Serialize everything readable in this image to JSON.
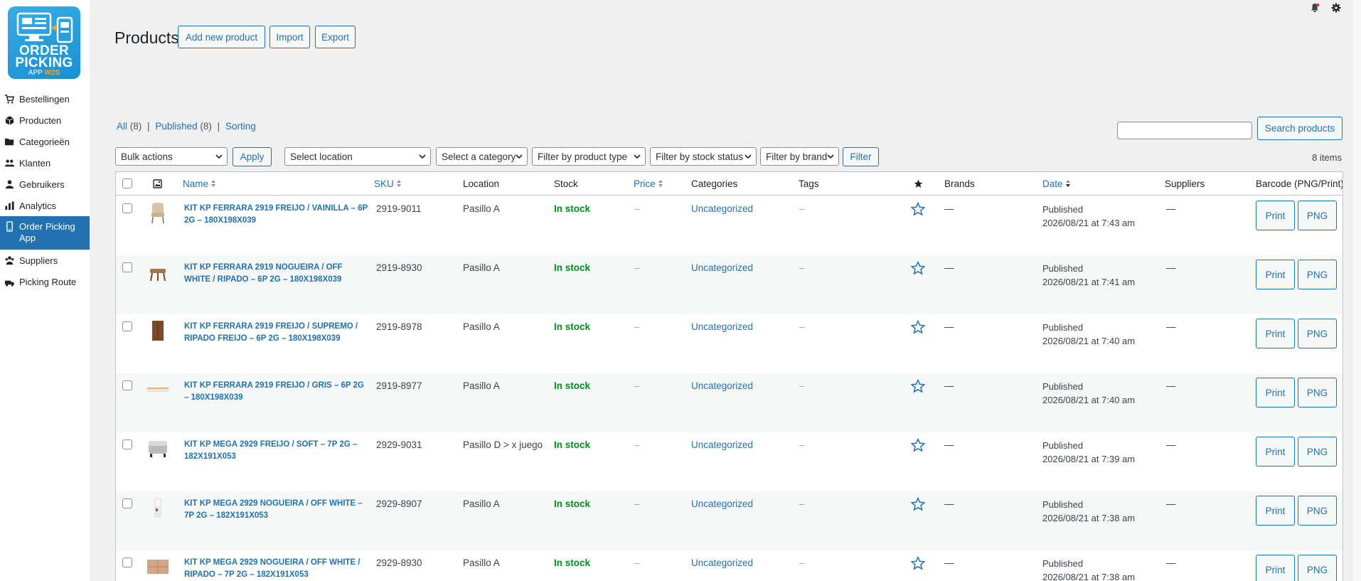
{
  "sidebar": {
    "logo": {
      "line1": "ORDER",
      "line2": "PICKING",
      "line3": "APP",
      "line3b": "W2S"
    },
    "items": [
      {
        "label": "Bestellingen",
        "icon": "cart-icon"
      },
      {
        "label": "Producten",
        "icon": "box-icon"
      },
      {
        "label": "Categorieën",
        "icon": "folder-icon"
      },
      {
        "label": "Klanten",
        "icon": "customers-icon"
      },
      {
        "label": "Gebruikers",
        "icon": "user-icon"
      },
      {
        "label": "Analytics",
        "icon": "bar-chart-icon"
      },
      {
        "label": "Order Picking App",
        "icon": "phone-icon",
        "active": true
      },
      {
        "label": "Suppliers",
        "icon": "suppliers-icon"
      },
      {
        "label": "Picking Route",
        "icon": "route-icon"
      }
    ]
  },
  "header": {
    "title": "Products",
    "buttons": [
      "Add new product",
      "Import",
      "Export"
    ]
  },
  "views": {
    "all": "All",
    "all_count": "(8)",
    "published": "Published",
    "published_count": "(8)",
    "sorting": "Sorting"
  },
  "search": {
    "placeholder": "",
    "button": "Search products"
  },
  "filters": {
    "bulk_actions": "Bulk actions",
    "apply": "Apply",
    "location": "Select location",
    "category": "Select a category",
    "product_type": "Filter by product type",
    "stock_status": "Filter by stock status",
    "brand": "Filter by brand",
    "filter_button": "Filter",
    "items_count": "8 items"
  },
  "columns": {
    "name": "Name",
    "sku": "SKU",
    "location": "Location",
    "stock": "Stock",
    "price": "Price",
    "categories": "Categories",
    "tags": "Tags",
    "brands": "Brands",
    "date": "Date",
    "suppliers": "Suppliers",
    "barcode": "Barcode (PNG/Print)"
  },
  "rows": [
    {
      "name": "KIT KP FERRARA 2919 FREIJO / VAINILLA – 6P 2G – 180X198X039",
      "sku": "2919-9011",
      "location": "Pasillo A",
      "stock": "In stock",
      "price": "–",
      "category": "Uncategorized",
      "tags": "–",
      "brands": "—",
      "date_status": "Published",
      "date": "2026/08/21 at 7:43 am",
      "suppliers": "—",
      "print": "Print",
      "png": "PNG",
      "thumb": "chair"
    },
    {
      "name": "KIT KP FERRARA 2919 NOGUEIRA / OFF WHITE / RIPADO – 6P 2G – 180X198X039",
      "sku": "2919-8930",
      "location": "Pasillo A",
      "stock": "In stock",
      "price": "–",
      "category": "Uncategorized",
      "tags": "–",
      "brands": "—",
      "date_status": "Published",
      "date": "2026/08/21 at 7:41 am",
      "suppliers": "—",
      "print": "Print",
      "png": "PNG",
      "thumb": "stool"
    },
    {
      "name": "KIT KP FERRARA 2919 FREIJO / SUPREMO / RIPADO FREIJO – 6P 2G – 180X198X039",
      "sku": "2919-8978",
      "location": "Pasillo A",
      "stock": "In stock",
      "price": "–",
      "category": "Uncategorized",
      "tags": "–",
      "brands": "—",
      "date_status": "Published",
      "date": "2026/08/21 at 7:40 am",
      "suppliers": "—",
      "print": "Print",
      "png": "PNG",
      "thumb": "cabinet"
    },
    {
      "name": "KIT KP FERRARA 2919 FREIJO / GRIS – 6P 2G – 180X198X039",
      "sku": "2919-8977",
      "location": "Pasillo A",
      "stock": "In stock",
      "price": "–",
      "category": "Uncategorized",
      "tags": "–",
      "brands": "—",
      "date_status": "Published",
      "date": "2026/08/21 at 7:40 am",
      "suppliers": "—",
      "print": "Print",
      "png": "PNG",
      "thumb": "shelf"
    },
    {
      "name": "KIT KP MEGA 2929 FREIJO / SOFT – 7P 2G – 182X191X053",
      "sku": "2929-9031",
      "location": "Pasillo D > x juego",
      "stock": "In stock",
      "price": "–",
      "category": "Uncategorized",
      "tags": "–",
      "brands": "—",
      "date_status": "Published",
      "date": "2026/08/21 at 7:39 am",
      "suppliers": "—",
      "print": "Print",
      "png": "PNG",
      "thumb": "ottoman"
    },
    {
      "name": "KIT KP MEGA 2929 NOGUEIRA / OFF WHITE – 7P 2G – 182X191X053",
      "sku": "2929-8907",
      "location": "Pasillo A",
      "stock": "In stock",
      "price": "–",
      "category": "Uncategorized",
      "tags": "–",
      "brands": "—",
      "date_status": "Published",
      "date": "2026/08/21 at 7:38 am",
      "suppliers": "—",
      "print": "Print",
      "png": "PNG",
      "thumb": "lamp"
    },
    {
      "name": "KIT KP MEGA 2929 NOGUEIRA / OFF WHITE / RIPADO – 7P 2G – 182X191X053",
      "sku": "2929-8930",
      "location": "Pasillo A",
      "stock": "In stock",
      "price": "–",
      "category": "Uncategorized",
      "tags": "–",
      "brands": "—",
      "date_status": "Published",
      "date": "2026/08/21 at 7:38 am",
      "suppliers": "—",
      "print": "Print",
      "png": "PNG",
      "thumb": "panel"
    }
  ],
  "colors": {
    "accent": "#2271b1",
    "in_stock": "#008a20",
    "sidebar_active": "#2271b1"
  }
}
